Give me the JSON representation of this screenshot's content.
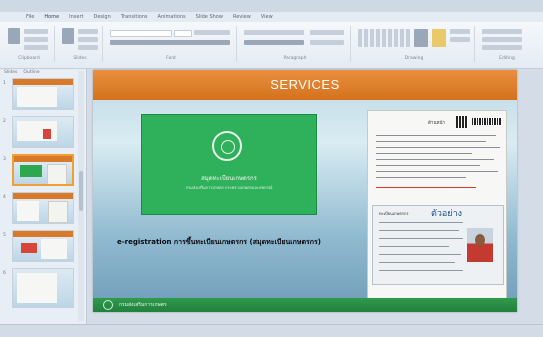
{
  "ribbon": {
    "tabs": [
      "File",
      "Home",
      "Insert",
      "Design",
      "Transitions",
      "Animations",
      "Slide Show",
      "Review",
      "View"
    ],
    "groups": [
      "Clipboard",
      "Slides",
      "Font",
      "Paragraph",
      "Drawing",
      "Editing"
    ]
  },
  "sidebar": {
    "tabs": [
      "Slides",
      "Outline"
    ],
    "thumbnails": [
      {
        "number": "1"
      },
      {
        "number": "2"
      },
      {
        "number": "3"
      },
      {
        "number": "4"
      },
      {
        "number": "5"
      },
      {
        "number": "6"
      }
    ]
  },
  "slide": {
    "title": "SERVICES",
    "book_title": "สมุดทะเบียนเกษตรกร",
    "book_subtitle": "กรมส่งเสริมการเกษตร กระทรวงเกษตรและสหกรณ์",
    "caption": "e-registration  การขึ้นทะเบียนเกษตรกร (สมุดทะเบียนเกษตรกร)",
    "doc_header": "ด้านหน้า",
    "card_name": "ตัวอย่าง",
    "card_header": "ทะเบียนเกษตรกร",
    "footer_text": "กรมส่งเสริมการเกษตร"
  },
  "colors": {
    "header": "#d97a2a",
    "footer": "#2f9a4c",
    "book": "#2fb05a"
  }
}
